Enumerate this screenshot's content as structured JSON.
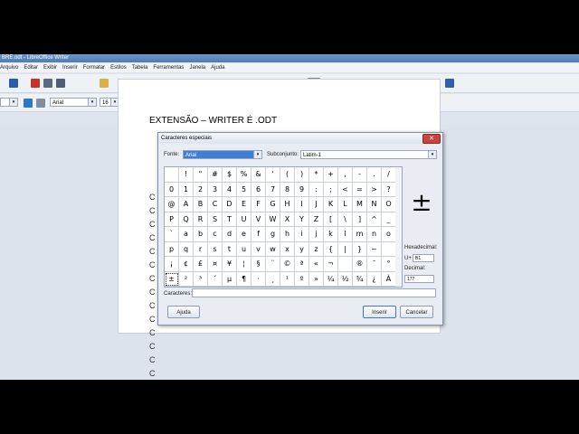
{
  "window": {
    "title": "BRE.odt - LibreOffice Writer"
  },
  "menu": [
    "Arquivo",
    "Editar",
    "Exibir",
    "Inserir",
    "Formatar",
    "Estilos",
    "Tabela",
    "Ferramentas",
    "Janela",
    "Ajuda"
  ],
  "formatting": {
    "font_name": "Arial",
    "font_size": "16"
  },
  "document": {
    "title": "EXTENSÃO – WRITER É .ODT",
    "bullet_char": "C",
    "bullet_count": 14
  },
  "dialog": {
    "title": "Caracteres especiais",
    "font_label": "Fonte:",
    "font_value": "Arial",
    "subset_label": "Subconjunto:",
    "subset_value": "Latim-1",
    "characters_label": "Caracteres:",
    "characters_value": "",
    "preview_char": "±",
    "hex_label": "Hexadecimal:",
    "hex_prefix": "U+",
    "hex_value": "B1",
    "dec_label": "Decimal:",
    "dec_value": "177",
    "help_button": "Ajuda",
    "insert_button": "Inserir",
    "cancel_button": "Cancelar",
    "selected_index": 112,
    "grid": [
      " ",
      "!",
      "\"",
      "#",
      "$",
      "%",
      "&",
      "'",
      "(",
      ")",
      "*",
      "+",
      ",",
      "-",
      ".",
      "/",
      "0",
      "1",
      "2",
      "3",
      "4",
      "5",
      "6",
      "7",
      "8",
      "9",
      ":",
      ";",
      "<",
      "=",
      ">",
      "?",
      "@",
      "A",
      "B",
      "C",
      "D",
      "E",
      "F",
      "G",
      "H",
      "I",
      "J",
      "K",
      "L",
      "M",
      "N",
      "O",
      "P",
      "Q",
      "R",
      "S",
      "T",
      "U",
      "V",
      "W",
      "X",
      "Y",
      "Z",
      "[",
      "\\",
      "]",
      "^",
      "_",
      "`",
      "a",
      "b",
      "c",
      "d",
      "e",
      "f",
      "g",
      "h",
      "i",
      "j",
      "k",
      "l",
      "m",
      "n",
      "o",
      "p",
      "q",
      "r",
      "s",
      "t",
      "u",
      "v",
      "w",
      "x",
      "y",
      "z",
      "{",
      "|",
      "}",
      "~",
      "",
      "¡",
      "¢",
      "£",
      "¤",
      "¥",
      "¦",
      "§",
      "¨",
      "©",
      "ª",
      "«",
      "¬",
      "",
      "®",
      "¯",
      "°",
      "±",
      "²",
      "³",
      "´",
      "µ",
      "¶",
      "·",
      "¸",
      "¹",
      "º",
      "»",
      "¼",
      "½",
      "¾",
      "¿",
      "À"
    ]
  }
}
